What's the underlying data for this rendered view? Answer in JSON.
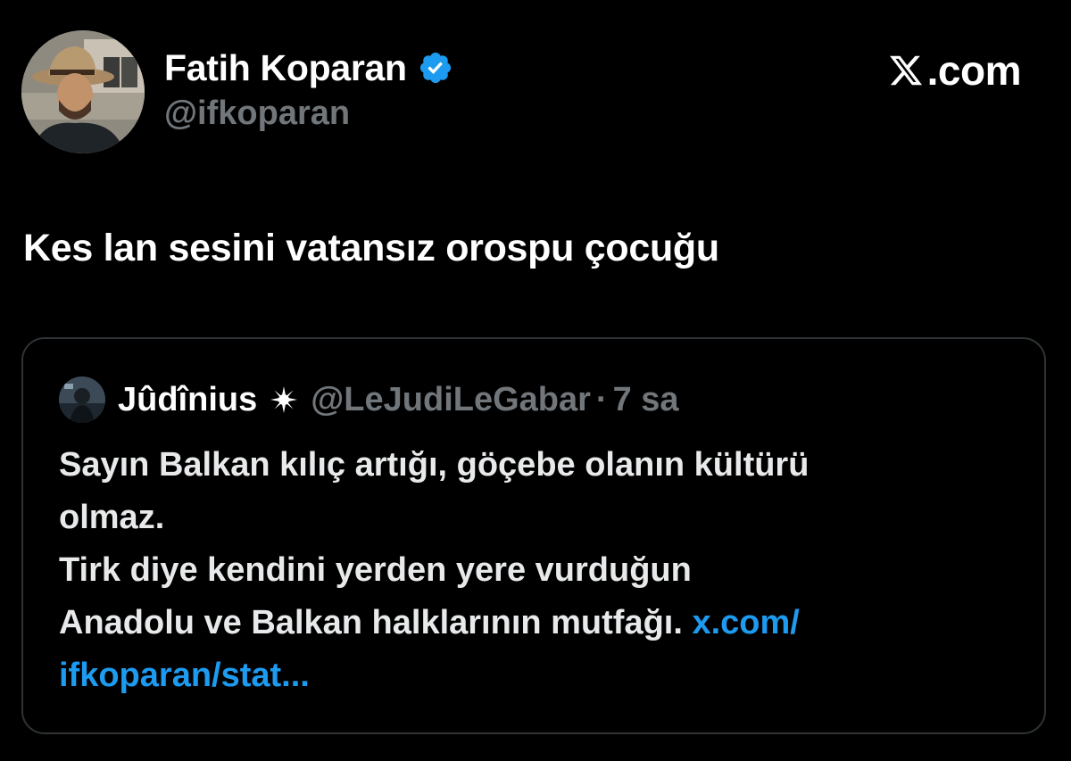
{
  "author": {
    "display_name": "Fatih Koparan",
    "handle": "@ifkoparan",
    "verified_icon": "verified-badge-icon",
    "avatar_icon": "profile-photo"
  },
  "brand": {
    "icon": "x-logo-icon",
    "label": ".com"
  },
  "tweet": {
    "text": "Kes lan sesini vatansız orospu çocuğu"
  },
  "quote": {
    "display_name": "Jûdînius",
    "badge_icon": "sun-burst-icon",
    "handle": "@LeJudiLeGabar",
    "separator": "·",
    "time": "7 sa",
    "lines": [
      "Sayın Balkan kılıç artığı, göçebe olanın kültürü",
      "olmaz.",
      "Tirk diye kendini yerden yere vurduğun",
      "Anadolu ve Balkan halklarının mutfağı. "
    ],
    "link_part1": "x.com/",
    "link_part2": "ifkoparan/stat..."
  },
  "colors": {
    "background": "#000000",
    "text": "#e7e9ea",
    "muted": "#71767b",
    "link": "#1d9bf0",
    "border": "#2f3336",
    "verified": "#1d9bf0"
  }
}
